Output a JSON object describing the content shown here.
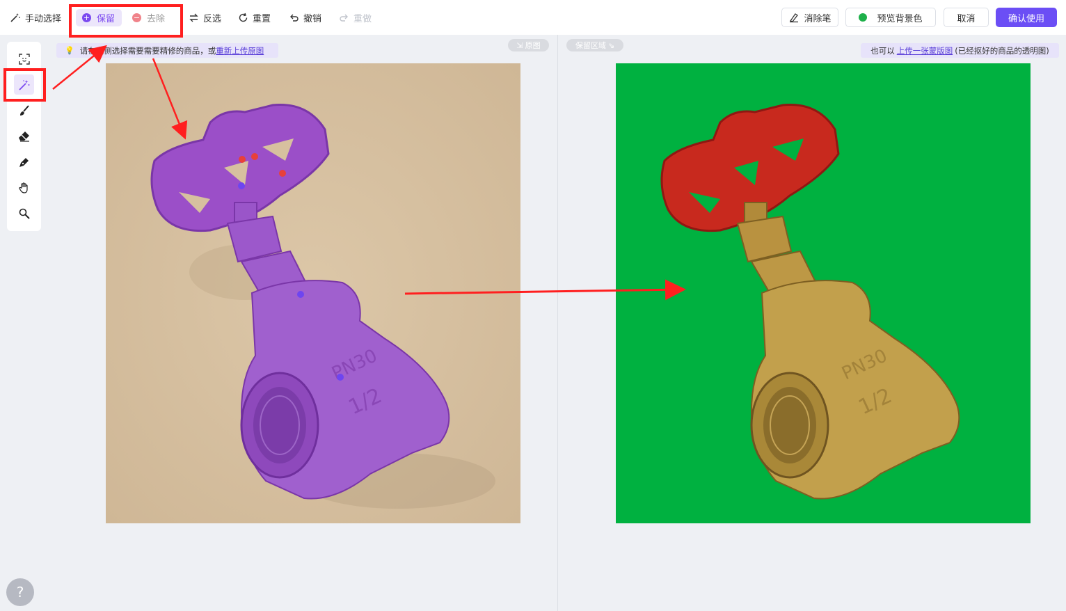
{
  "toolbar": {
    "manual_select": "手动选择",
    "keep": "保留",
    "remove": "去除",
    "invert": "反选",
    "reset": "重置",
    "undo": "撤销",
    "redo": "重做",
    "eraser_pen": "消除笔",
    "preview_bg": "预览背景色",
    "cancel": "取消",
    "confirm": "确认使用"
  },
  "left_pane": {
    "hint_prefix": "请在左侧选择需要需要精修的商品，或",
    "hint_link": "重新上传原图",
    "tag": "原图"
  },
  "right_pane": {
    "tag": "保留区域",
    "hint_prefix": "也可以",
    "hint_link": "上传一张蒙版图",
    "hint_suffix": "(已经抠好的商品的透明图)"
  },
  "valve": {
    "marking_line1": "PN30",
    "marking_line2": "1/2"
  },
  "help": "?",
  "colors": {
    "accent": "#6b4ef5",
    "keep_purple": "#7b4af0",
    "remove_pink": "#f0838a",
    "preview_green": "#00b140",
    "annotation_red": "#ff1f1f"
  },
  "icons": [
    "magic-wand-icon",
    "keep-plus-icon",
    "remove-minus-icon",
    "invert-icon",
    "reset-icon",
    "undo-icon",
    "redo-icon",
    "eraser-pen-icon",
    "face-select-icon",
    "magic-select-icon",
    "brush-icon",
    "eraser-icon",
    "pen-icon",
    "hand-icon",
    "zoom-icon"
  ]
}
